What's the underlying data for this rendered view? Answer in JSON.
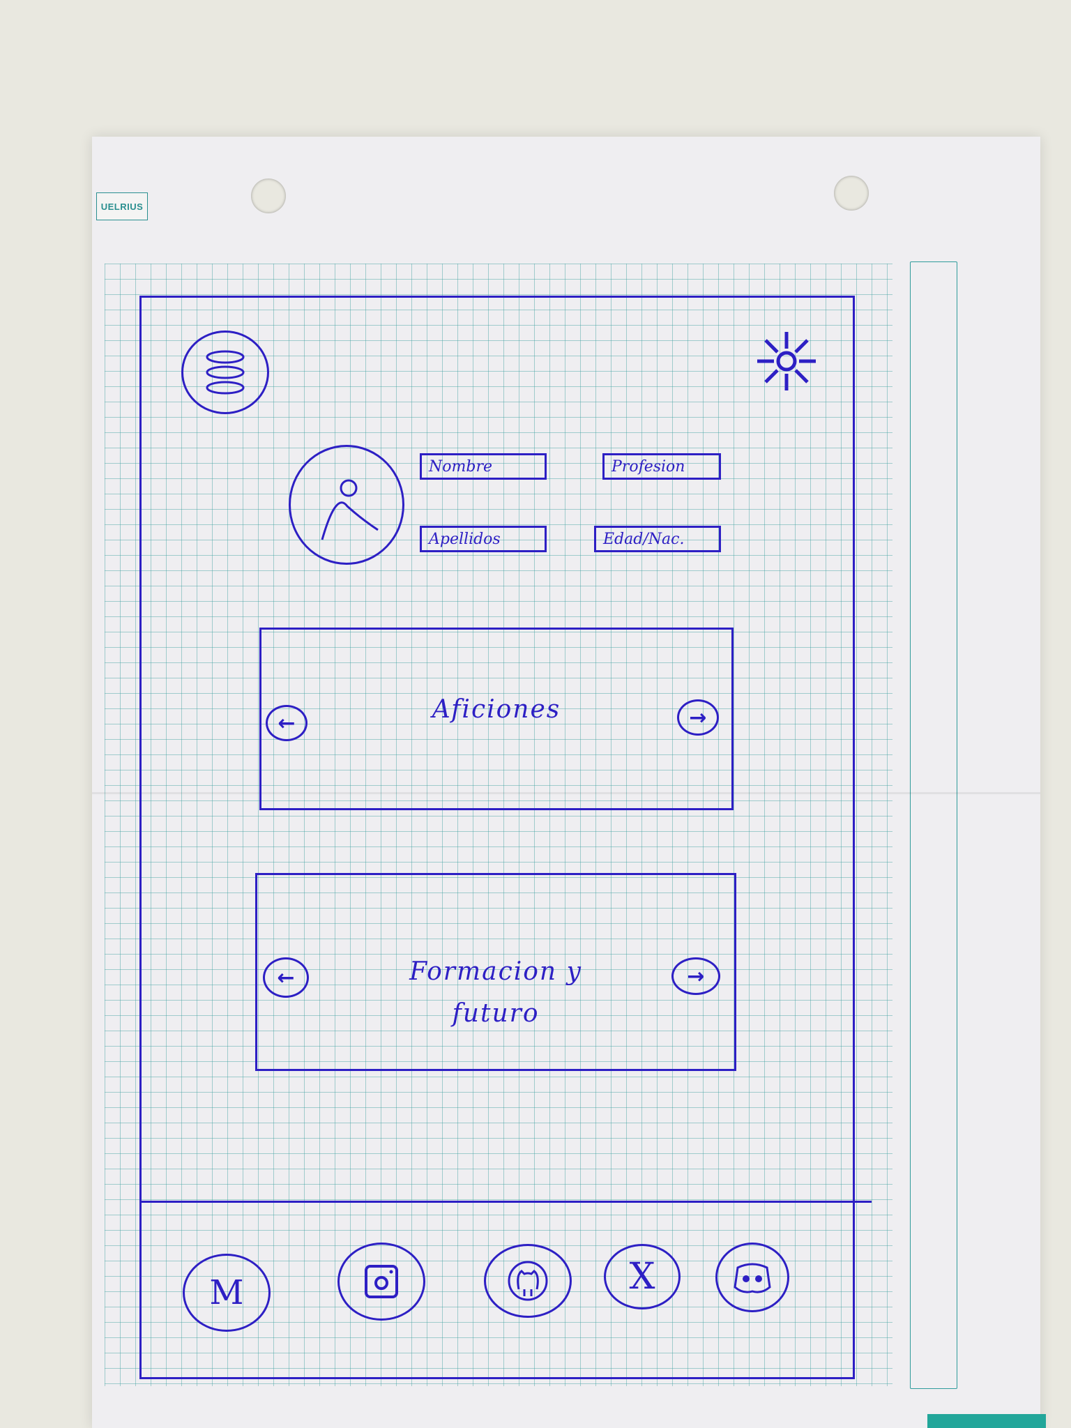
{
  "sheet": {
    "brand_tag": "UELRIUS"
  },
  "wireframe": {
    "profile": {
      "fields": {
        "nombre": "Nombre",
        "profesion": "Profesion",
        "apellidos": "Apellidos",
        "edad": "Edad/Nac."
      }
    },
    "cards": {
      "aficiones": {
        "title": "Aficiones",
        "prev_icon": "arrow-left-icon",
        "next_icon": "arrow-right-icon"
      },
      "formacion": {
        "title_line1": "Formacion y",
        "title_line2": "futuro",
        "prev_icon": "arrow-left-icon",
        "next_icon": "arrow-right-icon"
      }
    },
    "footer": {
      "social": [
        {
          "icon": "gmail-icon",
          "glyph": "M"
        },
        {
          "icon": "instagram-icon",
          "glyph": ""
        },
        {
          "icon": "github-icon",
          "glyph": ""
        },
        {
          "icon": "x-icon",
          "glyph": "X"
        },
        {
          "icon": "discord-icon",
          "glyph": ""
        }
      ]
    },
    "colors": {
      "ink": "#2d1fc4",
      "grid": "#3ea0a0",
      "paper": "#efeef1"
    }
  }
}
